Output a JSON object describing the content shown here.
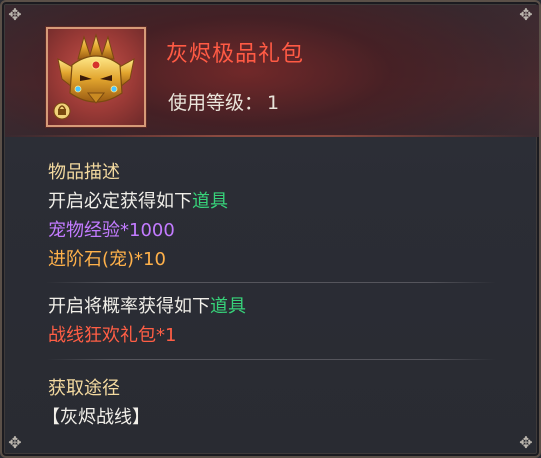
{
  "item": {
    "name": "灰烬极品礼包",
    "level_label": "使用等级：",
    "level_value": "1",
    "icon": "golden-helmet-icon"
  },
  "description": {
    "heading": "物品描述",
    "fixed_intro": "开启必定获得如下",
    "fixed_intro_highlight": "道具",
    "fixed_rewards": [
      {
        "name": "宠物经验",
        "qty": "*1000",
        "color": "#c37bff"
      },
      {
        "name": "进阶石(宠)",
        "qty": "*10",
        "color": "#ffb14a"
      }
    ],
    "chance_intro": "开启将概率获得如下",
    "chance_intro_highlight": "道具",
    "chance_rewards": [
      {
        "name": "战线狂欢礼包",
        "qty": "*1",
        "color": "#ff5e45"
      }
    ]
  },
  "source": {
    "heading": "获取途径",
    "value": "【灰烬战线】"
  },
  "colors": {
    "title": "#ff5a44",
    "heading": "#f3d99f",
    "highlight": "#37d37a"
  }
}
